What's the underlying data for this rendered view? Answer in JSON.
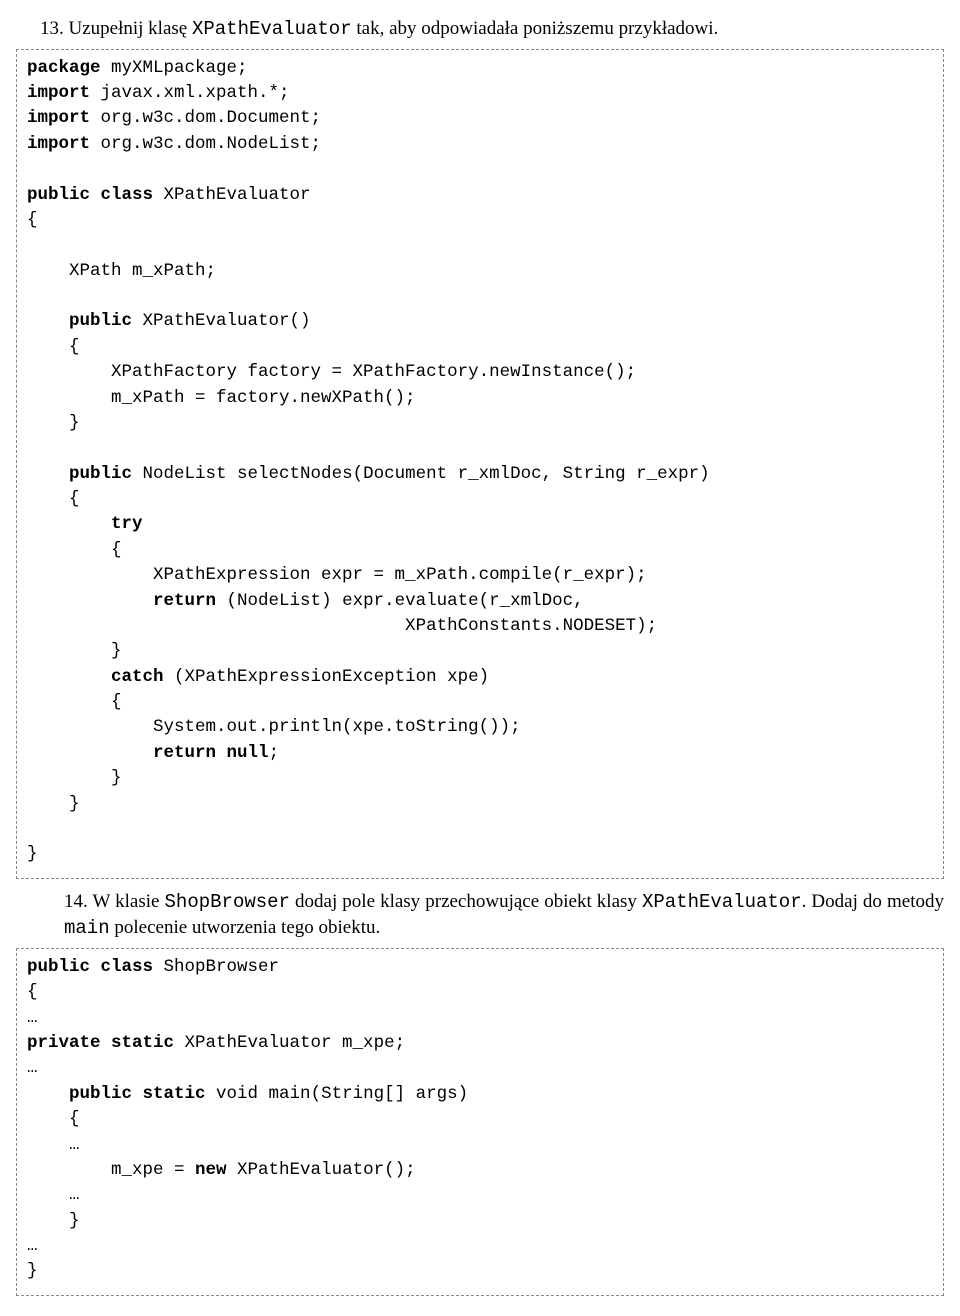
{
  "section13": {
    "number": "13.",
    "text_before_code": "Uzupełnij klasę ",
    "code_class": "XPathEvaluator",
    "text_after_code": " tak, aby odpowiadała poniższemu przykładowi."
  },
  "code1": {
    "l1a": "package",
    "l1b": " myXMLpackage;",
    "l2a": "import",
    "l2b": " javax.xml.xpath.*;",
    "l3a": "import",
    "l3b": " org.w3c.dom.Document;",
    "l4a": "import",
    "l4b": " org.w3c.dom.NodeList;",
    "l6a": "public class",
    "l6b": " XPathEvaluator",
    "l7": "{",
    "l9": "    XPath m_xPath;",
    "l11a": "    ",
    "l11b": "public",
    "l11c": " XPathEvaluator()",
    "l12": "    {",
    "l13": "        XPathFactory factory = XPathFactory.newInstance();",
    "l14": "        m_xPath = factory.newXPath();",
    "l15": "    }",
    "l17a": "    ",
    "l17b": "public",
    "l17c": " NodeList selectNodes(Document r_xmlDoc, String r_expr)",
    "l18": "    {",
    "l19a": "        ",
    "l19b": "try",
    "l20": "        {",
    "l21": "            XPathExpression expr = m_xPath.compile(r_expr);",
    "l22a": "            ",
    "l22b": "return",
    "l22c": " (NodeList) expr.evaluate(r_xmlDoc,",
    "l23": "                                    XPathConstants.NODESET);",
    "l24": "        }",
    "l25a": "        ",
    "l25b": "catch",
    "l25c": " (XPathExpressionException xpe)",
    "l26": "        {",
    "l27": "            System.out.println(xpe.toString());",
    "l28a": "            ",
    "l28b": "return null",
    "l28c": ";",
    "l29": "        }",
    "l30": "    }",
    "l32": "}"
  },
  "section14": {
    "number": "14.",
    "part1": "W klasie ",
    "code1": "ShopBrowser",
    "part2": " dodaj pole klasy przechowujące obiekt klasy ",
    "code2": "XPathEvaluator",
    "part3": ". Dodaj do metody ",
    "code3": "main",
    "part4": " polecenie utworzenia tego obiektu."
  },
  "code2": {
    "l1a": "public class",
    "l1b": " ShopBrowser",
    "l2": "{",
    "l3": "…",
    "l4a": "private static",
    "l4b": " XPathEvaluator m_xpe;",
    "l5": "…",
    "l6a": "    ",
    "l6b": "public static",
    "l6c": " void main(String[] args)",
    "l7": "    {",
    "l8": "    …",
    "l9a": "        m_xpe = ",
    "l9b": "new",
    "l9c": " XPathEvaluator();",
    "l10": "    …",
    "l11": "    }",
    "l12": "…",
    "l13": "}"
  }
}
